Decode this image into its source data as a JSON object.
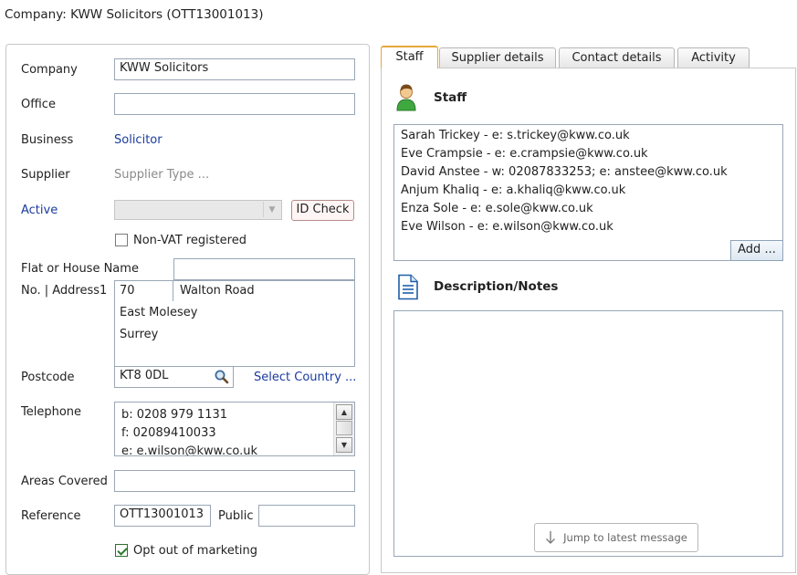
{
  "window": {
    "title": "Company: KWW Solicitors (OTT13001013)"
  },
  "form": {
    "company_label": "Company",
    "company_value": "KWW Solicitors",
    "office_label": "Office",
    "office_value": "",
    "business_label": "Business",
    "business_value": "Solicitor",
    "supplier_label": "Supplier",
    "supplier_value": "Supplier Type ...",
    "active_label": "Active",
    "id_check_label": "ID Check",
    "non_vat_label": "Non-VAT registered",
    "non_vat_checked": false,
    "flat_label": "Flat or House Name",
    "flat_value": "",
    "address_label": "No. | Address1",
    "house_no": "70",
    "address1": "Walton Road",
    "address2": "East Molesey",
    "address3": "Surrey",
    "postcode_label": "Postcode",
    "postcode_value": "KT8 0DL",
    "select_country_label": "Select Country ...",
    "telephone_label": "Telephone",
    "telephone_lines": [
      "b: 0208 979 1131",
      "f: 02089410033",
      "e: e.wilson@kww.co.uk"
    ],
    "areas_label": "Areas Covered",
    "areas_value": "",
    "reference_label": "Reference",
    "reference_value": "OTT13001013",
    "public_label": "Public",
    "public_value": "",
    "opt_out_label": "Opt out of marketing",
    "opt_out_checked": true
  },
  "tabs": [
    {
      "label": "Staff",
      "active": true
    },
    {
      "label": "Supplier details",
      "active": false
    },
    {
      "label": "Contact details",
      "active": false
    },
    {
      "label": "Activity",
      "active": false
    }
  ],
  "staff": {
    "heading": "Staff",
    "list": [
      "Sarah Trickey - e: s.trickey@kww.co.uk",
      "Eve Crampsie - e: e.crampsie@kww.co.uk",
      "David Anstee - w: 02087833253; e: anstee@kww.co.uk",
      "Anjum Khaliq - e: a.khaliq@kww.co.uk",
      "Enza Sole - e: e.sole@kww.co.uk",
      "Eve Wilson - e: e.wilson@kww.co.uk"
    ],
    "add_label": "Add ..."
  },
  "notes": {
    "heading": "Description/Notes",
    "jump_label": "Jump to latest message"
  },
  "colors": {
    "link_blue": "#1a3b9e",
    "active_tab_accent": "#e8a83a",
    "field_border": "#9aa7b6"
  }
}
